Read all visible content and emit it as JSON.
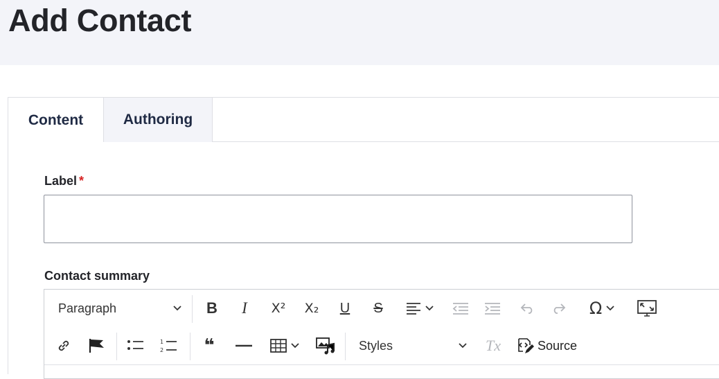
{
  "page": {
    "title": "Add Contact"
  },
  "tabs": [
    {
      "label": "Content",
      "active": true
    },
    {
      "label": "Authoring",
      "active": false
    }
  ],
  "form": {
    "label_field": {
      "label": "Label",
      "required_marker": "*",
      "value": ""
    },
    "summary_field": {
      "label": "Contact summary"
    }
  },
  "toolbar": {
    "row1": {
      "paragraph": "Paragraph",
      "bold": "B",
      "italic": "I",
      "superscript": "X²",
      "subscript": "X₂",
      "underline": "U",
      "strikethrough": "S",
      "special_chars": "Ω"
    },
    "row2": {
      "blockquote": "❝",
      "styles": "Styles",
      "remove_format": "Tx",
      "source": "Source"
    }
  },
  "icons": [
    "bold-icon",
    "italic-icon",
    "superscript-icon",
    "subscript-icon",
    "underline-icon",
    "strikethrough-icon",
    "align-icon",
    "outdent-icon",
    "indent-icon",
    "undo-icon",
    "redo-icon",
    "special-characters-icon",
    "fullscreen-icon",
    "link-icon",
    "flag-icon",
    "bulleted-list-icon",
    "numbered-list-icon",
    "blockquote-icon",
    "horizontal-line-icon",
    "table-icon",
    "media-icon",
    "remove-format-icon",
    "source-icon"
  ]
}
